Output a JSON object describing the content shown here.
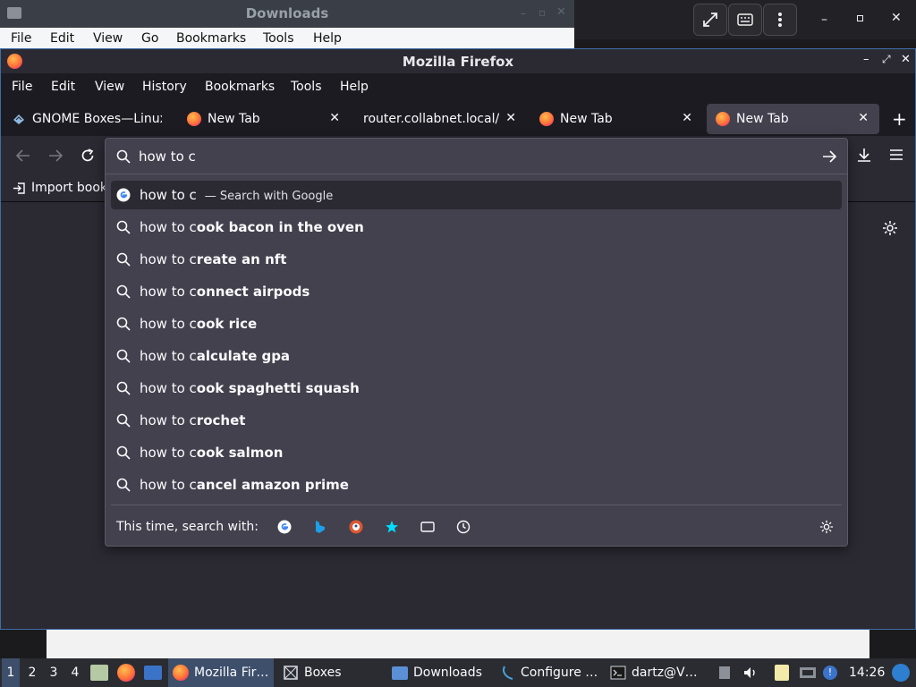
{
  "downloads_window": {
    "title": "Downloads",
    "menu": [
      "File",
      "Edit",
      "View",
      "Go",
      "Bookmarks",
      "Tools",
      "Help"
    ]
  },
  "firefox": {
    "title": "Mozilla Firefox",
    "menu": [
      "File",
      "Edit",
      "View",
      "History",
      "Bookmarks",
      "Tools",
      "Help"
    ],
    "tabs": [
      {
        "label": "GNOME Boxes—Linux",
        "icon": "gnome-boxes-icon"
      },
      {
        "label": "New Tab",
        "icon": "firefox-icon"
      },
      {
        "label": "router.collabnet.local/",
        "icon": "none"
      },
      {
        "label": "New Tab",
        "icon": "firefox-icon"
      },
      {
        "label": "New Tab",
        "icon": "firefox-icon",
        "selected": true
      }
    ],
    "bookmarks_toolbar": {
      "import_label": "Import book"
    },
    "urlbar": {
      "value": "how to c",
      "first_result": {
        "typed": "how to c",
        "separator": "—",
        "action": "Search with Google"
      },
      "suggestions": [
        {
          "prefix": "how to c",
          "completion": "ook bacon in the oven"
        },
        {
          "prefix": "how to c",
          "completion": "reate an nft"
        },
        {
          "prefix": "how to c",
          "completion": "onnect airpods"
        },
        {
          "prefix": "how to c",
          "completion": "ook rice"
        },
        {
          "prefix": "how to c",
          "completion": "alculate gpa"
        },
        {
          "prefix": "how to c",
          "completion": "ook spaghetti squash"
        },
        {
          "prefix": "how to c",
          "completion": "rochet"
        },
        {
          "prefix": "how to c",
          "completion": "ook salmon"
        },
        {
          "prefix": "how to c",
          "completion": "ancel amazon prime"
        }
      ],
      "oneoff_label": "This time, search with:"
    }
  },
  "taskbar": {
    "workspaces": [
      "1",
      "2",
      "3",
      "4"
    ],
    "items": [
      {
        "label": "Mozilla Fir…",
        "icon": "firefox-icon"
      },
      {
        "label": "Boxes",
        "icon": "boxes-icon"
      },
      {
        "label": "Downloads",
        "icon": "folder-icon"
      },
      {
        "label": "Configure …",
        "icon": "configure-icon"
      },
      {
        "label": "dartz@V…",
        "icon": "terminal-icon"
      }
    ],
    "clock": "14:26"
  },
  "colors": {
    "accent": "#3d6ea8",
    "panel_bg": "#42414d",
    "toolbar_bg": "#2b2a33",
    "text": "#fbfbfe"
  }
}
